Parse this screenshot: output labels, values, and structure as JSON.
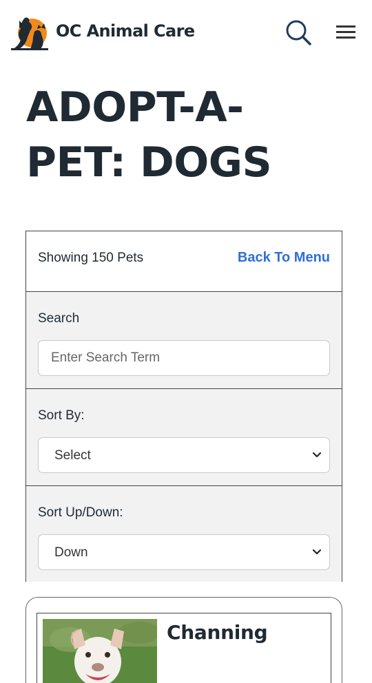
{
  "header": {
    "brand": "OC Animal Care",
    "logo_icon": "oc-animal-care-logo",
    "search_icon": "search-icon",
    "menu_icon": "hamburger-menu-icon"
  },
  "page": {
    "title_line1": "ADOPT-A-",
    "title_line2": "PET: DOGS"
  },
  "filter_panel": {
    "showing_text": "Showing 150 Pets",
    "back_link": "Back To Menu",
    "search": {
      "label": "Search",
      "placeholder": "Enter Search Term",
      "value": ""
    },
    "sort_by": {
      "label": "Sort By:",
      "selected": "Select"
    },
    "sort_direction": {
      "label": "Sort Up/Down:",
      "selected": "Down"
    }
  },
  "pets": [
    {
      "name": "Channing"
    }
  ],
  "colors": {
    "text": "#1f2a33",
    "link": "#2f6fd6",
    "logo_orange": "#f08a1c",
    "panel_bg": "#f2f2f2"
  }
}
